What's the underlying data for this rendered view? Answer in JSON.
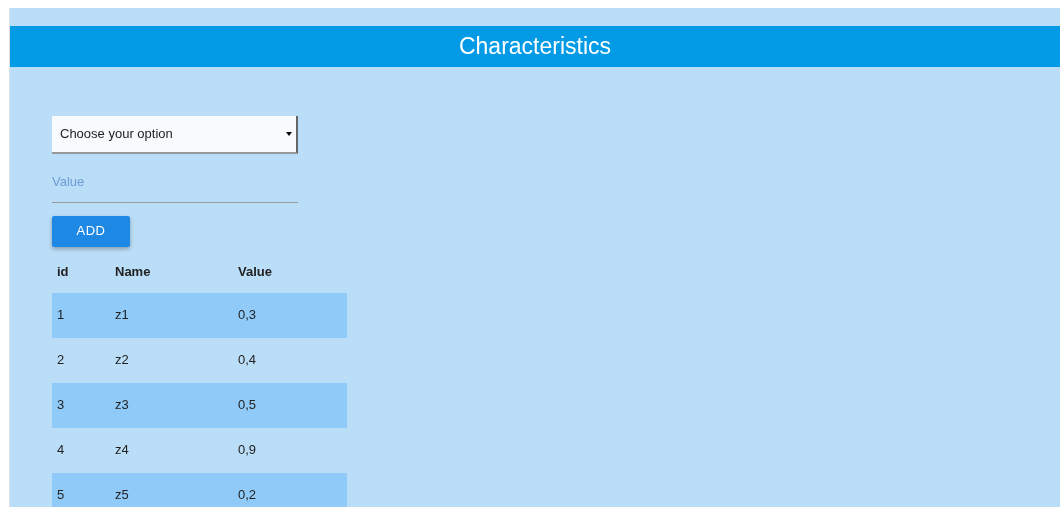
{
  "header": {
    "title": "Characteristics"
  },
  "select": {
    "value": "Choose your option"
  },
  "value_field": {
    "placeholder": "Value"
  },
  "add_button": {
    "label": "ADD"
  },
  "table": {
    "columns": [
      "id",
      "Name",
      "Value"
    ],
    "rows": [
      [
        "1",
        "z1",
        "0,3"
      ],
      [
        "2",
        "z2",
        "0,4"
      ],
      [
        "3",
        "z3",
        "0,5"
      ],
      [
        "4",
        "z4",
        "0,9"
      ],
      [
        "5",
        "z5",
        "0,2"
      ]
    ]
  }
}
